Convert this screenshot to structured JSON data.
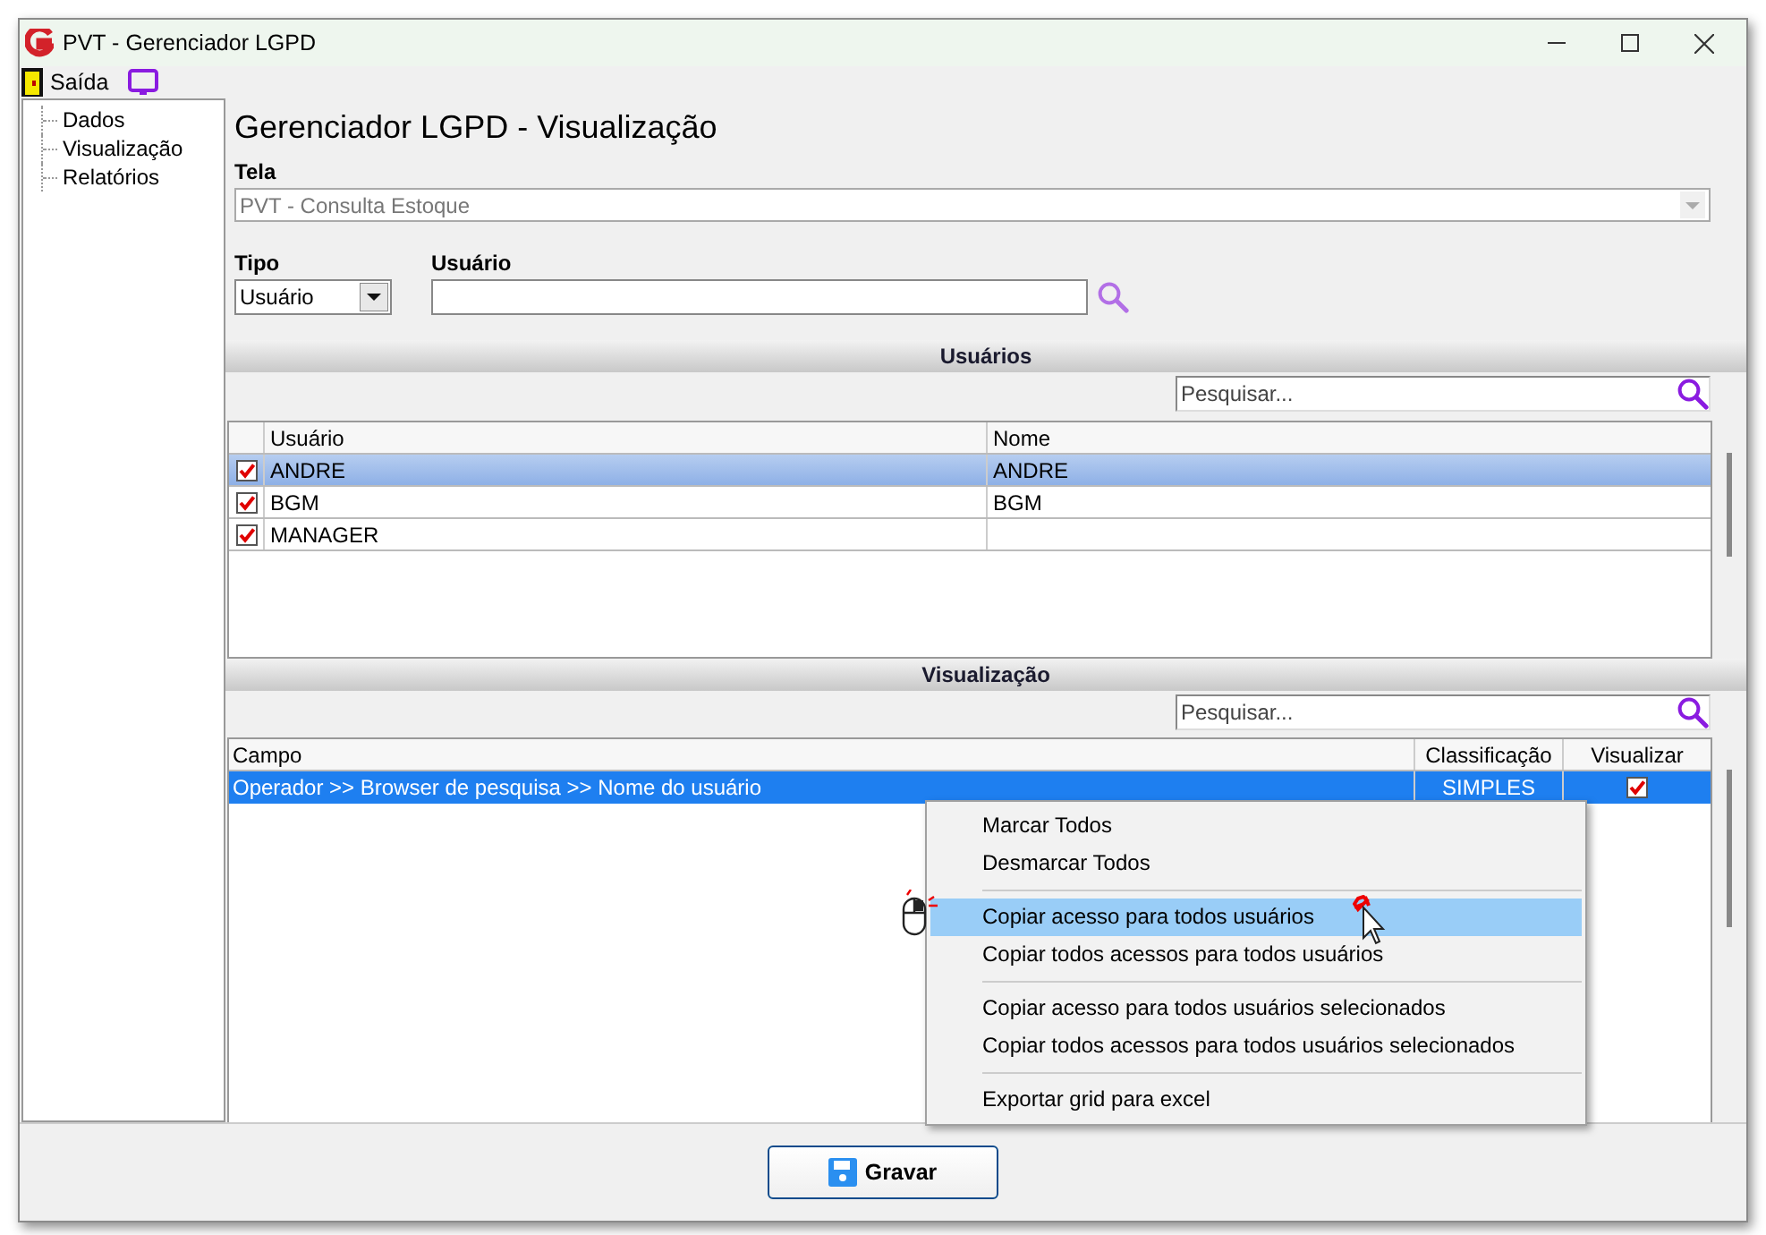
{
  "window": {
    "title": "PVT - Gerenciador LGPD"
  },
  "menu_bar": {
    "items": [
      {
        "label": "Saída"
      }
    ]
  },
  "sidebar": {
    "items": [
      {
        "label": "Dados",
        "selected": false
      },
      {
        "label": "Visualização",
        "selected": false
      },
      {
        "label": "Relatórios",
        "selected": false
      }
    ]
  },
  "heading": "Gerenciador LGPD - Visualização",
  "tela": {
    "label": "Tela",
    "value": "PVT - Consulta Estoque"
  },
  "tipo": {
    "label": "Tipo",
    "value": "Usuário"
  },
  "usuario": {
    "label": "Usuário"
  },
  "usuarios_panel": {
    "title": "Usuários",
    "search_placeholder": "Pesquisar...",
    "columns": [
      "Usuário",
      "Nome"
    ],
    "rows": [
      {
        "checked": true,
        "selected": true,
        "usuario": "ANDRE",
        "nome": "ANDRE"
      },
      {
        "checked": true,
        "selected": false,
        "usuario": "BGM",
        "nome": "BGM"
      },
      {
        "checked": true,
        "selected": false,
        "usuario": "MANAGER",
        "nome": ""
      }
    ]
  },
  "visualizacao_panel": {
    "title": "Visualização",
    "search_placeholder": "Pesquisar...",
    "columns": [
      "Campo",
      "Classificação",
      "Visualizar"
    ],
    "rows": [
      {
        "selected": true,
        "campo": "Operador >> Browser de pesquisa >> Nome do usuário",
        "classificacao": "SIMPLES",
        "visualizar": true
      }
    ]
  },
  "context_menu": {
    "items": [
      {
        "label": "Marcar Todos",
        "selected": false,
        "separator_before": false
      },
      {
        "label": "Desmarcar Todos",
        "selected": false,
        "separator_before": false
      },
      {
        "label": "Copiar acesso para todos usuários",
        "selected": true,
        "separator_before": true
      },
      {
        "label": "Copiar todos acessos para todos usuários",
        "selected": false,
        "separator_before": false
      },
      {
        "label": "Copiar acesso para todos usuários selecionados",
        "selected": false,
        "separator_before": true
      },
      {
        "label": "Copiar todos acessos para todos usuários selecionados",
        "selected": false,
        "separator_before": false
      },
      {
        "label": "Exportar grid para excel",
        "selected": false,
        "separator_before": true
      }
    ]
  },
  "buttons": [
    {
      "label": "Gravar"
    }
  ]
}
